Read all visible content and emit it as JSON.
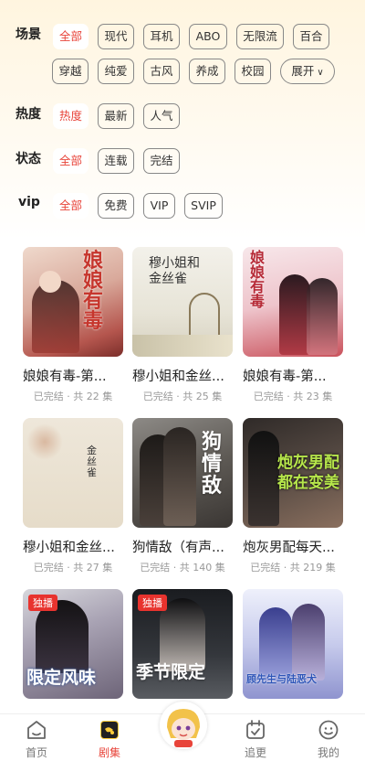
{
  "filters": {
    "scene": {
      "label": "场景",
      "options": [
        "全部",
        "现代",
        "耳机",
        "ABO",
        "无限流",
        "百合",
        "穿越",
        "纯爱",
        "古风",
        "养成",
        "校园"
      ],
      "expand_label": "展开",
      "selected": "全部"
    },
    "heat": {
      "label": "热度",
      "options": [
        "热度",
        "最新",
        "人气"
      ],
      "selected": "热度"
    },
    "status": {
      "label": "状态",
      "options": [
        "全部",
        "连载",
        "完结"
      ],
      "selected": "全部"
    },
    "vip": {
      "label": "vip",
      "options": [
        "全部",
        "免费",
        "VIP",
        "SVIP"
      ],
      "selected": "全部"
    }
  },
  "colors": {
    "accent": "#e8443a",
    "badge": "#e8332e"
  },
  "dramas": [
    {
      "title": "娘娘有毒-第...",
      "meta": "已完结 · 共 22 集",
      "cover_text": "娘娘有毒",
      "badge": ""
    },
    {
      "title": "穆小姐和金丝...",
      "meta": "已完结 · 共 25 集",
      "cover_text": "穆小姐和金丝雀",
      "badge": ""
    },
    {
      "title": "娘娘有毒-第...",
      "meta": "已完结 · 共 23 集",
      "cover_text": "娘娘有毒",
      "badge": ""
    },
    {
      "title": "穆小姐和金丝...",
      "meta": "已完结 · 共 27 集",
      "cover_text": "金丝雀",
      "badge": ""
    },
    {
      "title": "狗情敌（有声...",
      "meta": "已完结 · 共 140 集",
      "cover_text": "狗情敌",
      "badge": ""
    },
    {
      "title": "炮灰男配每天...",
      "meta": "已完结 · 共 219 集",
      "cover_text": "炮灰男配 都在变美",
      "badge": ""
    },
    {
      "title": "",
      "meta": "",
      "cover_text": "限定风味",
      "badge": "独播"
    },
    {
      "title": "",
      "meta": "",
      "cover_text": "季节限定",
      "badge": "独播"
    },
    {
      "title": "",
      "meta": "",
      "cover_text": "顾先生与陆恶犬",
      "badge": ""
    }
  ],
  "tabbar": {
    "items": [
      {
        "label": "首页",
        "icon": "home-icon"
      },
      {
        "label": "剧集",
        "icon": "drama-icon"
      },
      {
        "label": "",
        "icon": "mascot-icon"
      },
      {
        "label": "追更",
        "icon": "follow-icon"
      },
      {
        "label": "我的",
        "icon": "profile-icon"
      }
    ],
    "active": "剧集"
  }
}
